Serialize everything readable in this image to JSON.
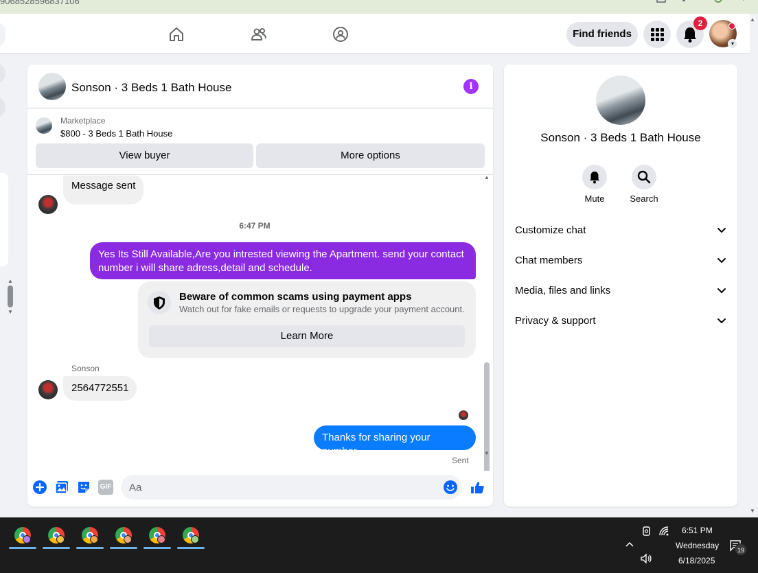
{
  "browser": {
    "url_fragment": "90685285968371​06"
  },
  "topnav": {
    "find_friends_label": "Find friends",
    "notification_count": "2"
  },
  "chat": {
    "title": "Sonson · 3 Beds 1 Bath House",
    "marketplace_label": "Marketplace",
    "listing": "$800 - 3 Beds 1 Bath House",
    "view_buyer_label": "View buyer",
    "more_options_label": "More options",
    "messages": {
      "first_incoming": "Message sent",
      "timestamp": "6:47 PM",
      "outgoing_1": "Yes Its Still Available,Are you intrested viewing the Apartment. send your contact number i will share adress,detail and schedule.",
      "scam_title": "Beware of common scams using payment apps",
      "scam_subtitle": "Watch out for fake emails or requests to upgrade your payment account.",
      "learn_more_label": "Learn More",
      "sender_name": "Sonson",
      "incoming_2": "2564772551",
      "outgoing_2": "Thanks for sharing your number",
      "sent_status": "Sent"
    },
    "composer_placeholder": "Aa",
    "gif_label": "GIF"
  },
  "right_panel": {
    "title": "Sonson · 3 Beds 1 Bath House",
    "mute_label": "Mute",
    "search_label": "Search",
    "rows": [
      {
        "label": "Customize chat"
      },
      {
        "label": "Chat members"
      },
      {
        "label": "Media, files and links"
      },
      {
        "label": "Privacy & support"
      }
    ]
  },
  "taskbar": {
    "time": "6:51 PM",
    "day": "Wednesday",
    "date": "6/18/2025",
    "notification_count": "19",
    "apps": [
      {
        "name": "chrome-1",
        "profile_color": "#b47ae6"
      },
      {
        "name": "chrome-2",
        "profile_color": "#f2c14e"
      },
      {
        "name": "chrome-3",
        "profile_color": "#f2a54e"
      },
      {
        "name": "chrome-4",
        "profile_color": "#e8a67e"
      },
      {
        "name": "chrome-5",
        "profile_color": "#e87e8a"
      },
      {
        "name": "chrome-6",
        "profile_color": "#9bd18a"
      }
    ]
  },
  "colors": {
    "purple_bubble": "#8a2be2",
    "blue_bubble": "#0a7cff",
    "fb_blue": "#0866ff",
    "info_purple": "#a033ff"
  }
}
